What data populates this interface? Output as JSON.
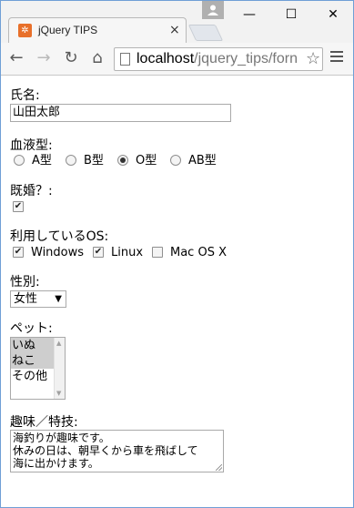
{
  "browser": {
    "tab_title": "jQuery TIPS",
    "tab_favicon": "jquery-favicon",
    "url_host": "localhost",
    "url_path": "/jquery_tips/forn",
    "window_controls": {
      "minimize": "—",
      "maximize": "☐",
      "close": "✕"
    }
  },
  "form": {
    "name": {
      "label": "氏名:",
      "value": "山田太郎"
    },
    "blood": {
      "label": "血液型:",
      "options": [
        {
          "label": "A型",
          "checked": false
        },
        {
          "label": "B型",
          "checked": false
        },
        {
          "label": "O型",
          "checked": true
        },
        {
          "label": "AB型",
          "checked": false
        }
      ]
    },
    "married": {
      "label": "既婚？:",
      "checked": true
    },
    "os": {
      "label": "利用しているOS:",
      "options": [
        {
          "label": "Windows",
          "checked": true
        },
        {
          "label": "Linux",
          "checked": true
        },
        {
          "label": "Mac OS X",
          "checked": false
        }
      ]
    },
    "gender": {
      "label": "性別:",
      "selected": "女性"
    },
    "pet": {
      "label": "ペット:",
      "items": [
        {
          "label": "いぬ",
          "selected": true
        },
        {
          "label": "ねこ",
          "selected": true
        },
        {
          "label": "その他",
          "selected": false
        }
      ]
    },
    "hobby": {
      "label": "趣味／特技:",
      "lines": [
        "海釣りが趣味です。",
        "休みの日は、朝早くから車を飛ばして",
        "海に出かけます。"
      ]
    }
  }
}
